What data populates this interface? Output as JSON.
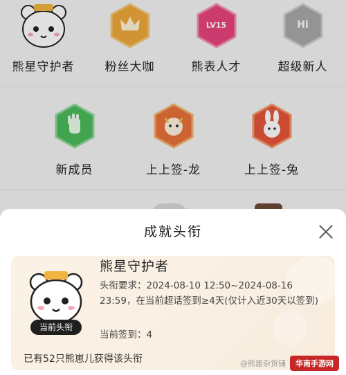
{
  "badges_row1": [
    {
      "label": "熊星守护者",
      "icon": "bear-face-icon"
    },
    {
      "label": "粉丝大咖",
      "icon": "crown-hex-icon"
    },
    {
      "label": "熊表人才",
      "icon": "lv15-hex-icon",
      "hex_text": "LV15"
    },
    {
      "label": "超级新人",
      "icon": "hi-hex-icon",
      "hex_text": "Hi"
    }
  ],
  "badges_row2": [
    {
      "label": "新成员",
      "icon": "hand-hex-icon"
    },
    {
      "label": "上上签-龙",
      "icon": "dragon-hex-icon"
    },
    {
      "label": "上上签-兔",
      "icon": "rabbit-hex-icon"
    }
  ],
  "sheet": {
    "title": "成就头衔",
    "card": {
      "name": "熊星守护者",
      "requirement": "头衔要求：2024-08-10 12:50~2024-08-16 23:59，在当前超话签到≥4天(仅计入近30天以签到)",
      "progress": "当前签到：4",
      "current_tag": "当前头衔",
      "owned": "已有52只熊崽儿获得该头衔"
    }
  },
  "watermark": {
    "text": "@熊崽杂货铺",
    "logo": "华南手游网"
  },
  "colors": {
    "gold": "#f0a93b",
    "pink": "#e8447e",
    "gray": "#a9a9a9",
    "green": "#4cbb5a",
    "red_orange": "#e8713a"
  }
}
